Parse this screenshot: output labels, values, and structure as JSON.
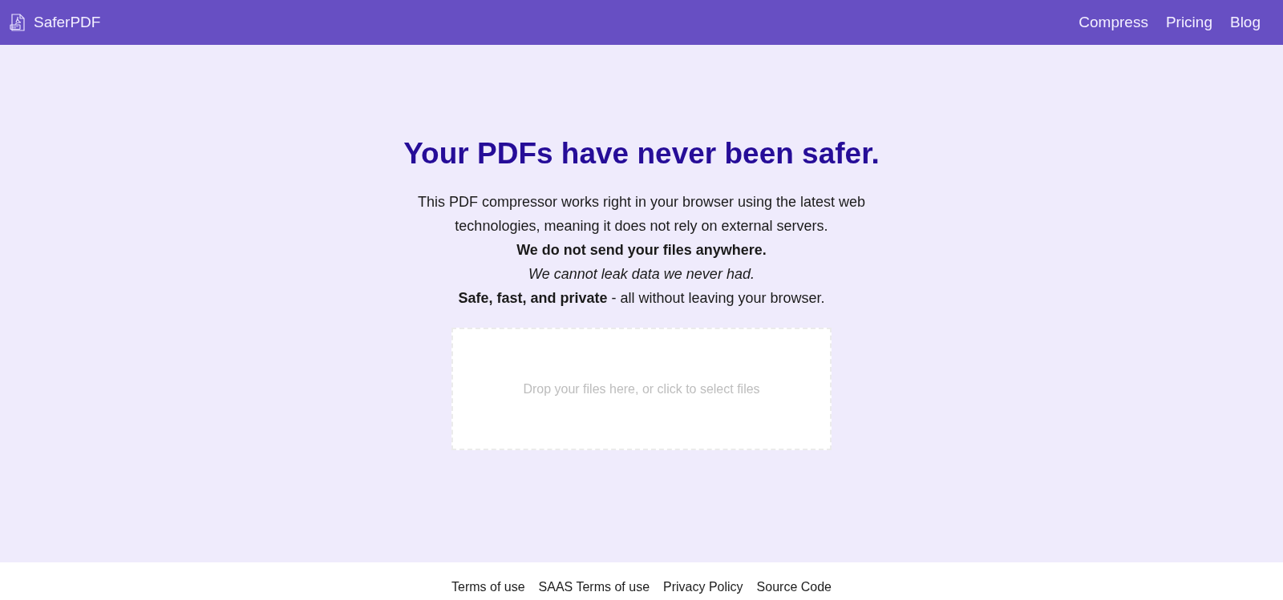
{
  "nav": {
    "brand": "SaferPDF",
    "links": [
      {
        "label": "Compress"
      },
      {
        "label": "Pricing"
      },
      {
        "label": "Blog"
      }
    ]
  },
  "hero": {
    "title": "Your PDFs have never been safer.",
    "lines": [
      {
        "kind": "plain",
        "text": "This PDF compressor works right in your browser using the latest web technologies, meaning it does not rely on external servers."
      },
      {
        "kind": "bold",
        "text": "We do not send your files anywhere."
      },
      {
        "kind": "italic",
        "text": "We cannot leak data we never had."
      },
      {
        "kind": "rich",
        "text": "**Safe, fast, and private** - all without leaving your browser."
      }
    ]
  },
  "dropzone": {
    "prompt": "Drop your files here, or click to select files"
  },
  "footer": {
    "links": [
      {
        "label": "Terms of use"
      },
      {
        "label": "SAAS Terms of use"
      },
      {
        "label": "Privacy Policy"
      },
      {
        "label": "Source Code"
      }
    ]
  }
}
